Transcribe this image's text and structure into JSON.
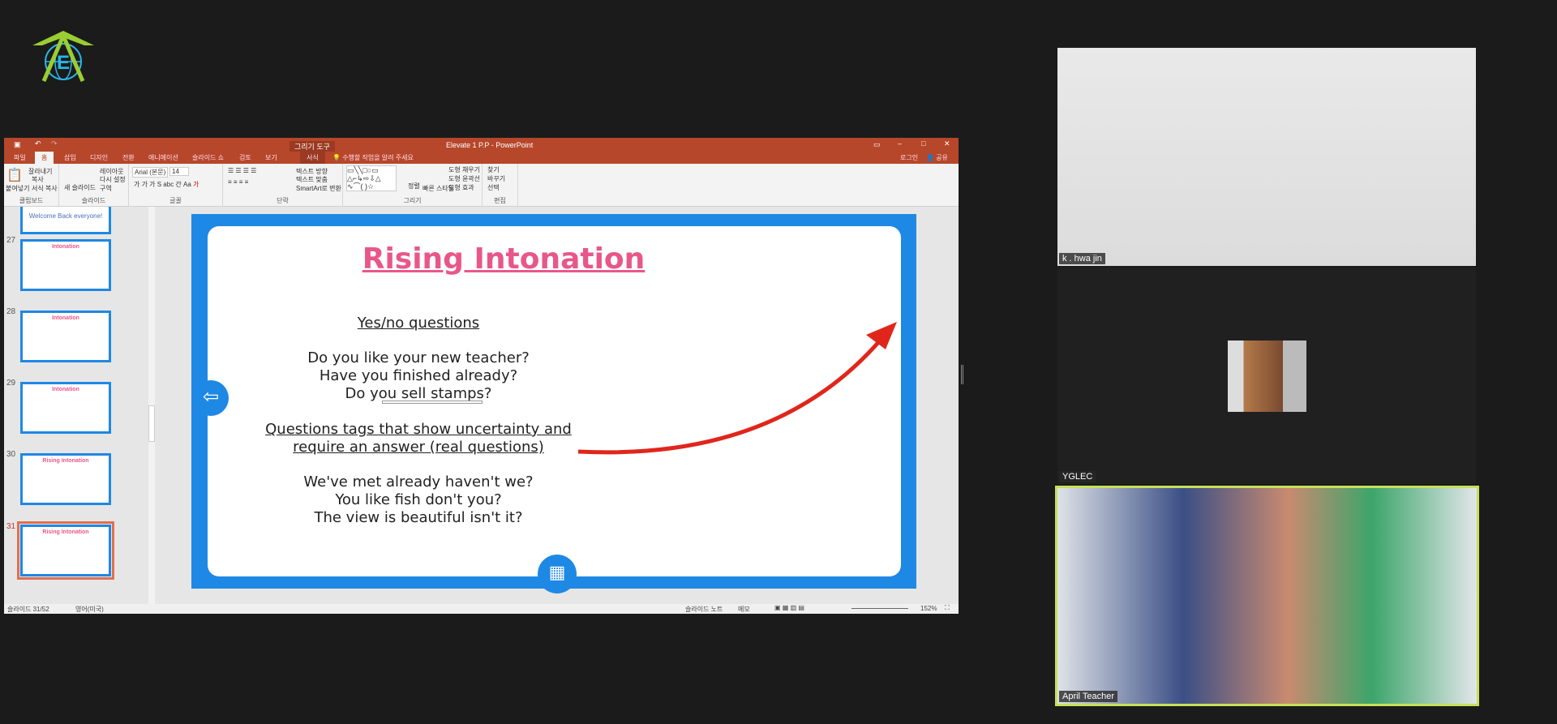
{
  "logo": {
    "name": "elevate-logo",
    "colors": {
      "arrow": "#9acd32",
      "globe": "#29b6e6"
    }
  },
  "ppt": {
    "window_title": "Elevate 1 P.P - PowerPoint",
    "context_tab": "그리기 도구",
    "tabs": [
      "파일",
      "홈",
      "삽입",
      "디자인",
      "전환",
      "애니메이션",
      "슬라이드 쇼",
      "검토",
      "보기",
      "서식"
    ],
    "tell_me": "수행할 작업을 알려 주세요",
    "signin": "로그인",
    "share": "공유",
    "ribbon": {
      "clipboard": {
        "paste": "붙여넣기",
        "cut": "잘라내기",
        "copy": "복사",
        "format_painter": "서식 복사",
        "label": "클립보드"
      },
      "slides": {
        "new_slide": "새 슬라이드",
        "layout": "레이아웃",
        "reset": "다시 설정",
        "section": "구역",
        "label": "슬라이드"
      },
      "font": {
        "name": "Arial (본문)",
        "size": "14",
        "label": "글꼴"
      },
      "paragraph": {
        "text_direction": "텍스트 방향",
        "align_text": "텍스트 맞춤",
        "smartart": "SmartArt로 변환",
        "label": "단락"
      },
      "drawing": {
        "arrange": "정렬",
        "quick_styles": "빠른 스타일",
        "fill": "도형 채우기",
        "outline": "도형 윤곽선",
        "effects": "도형 효과",
        "label": "그리기"
      },
      "editing": {
        "find": "찾기",
        "replace": "바꾸기",
        "select": "선택",
        "label": "편집"
      }
    },
    "thumbnails": [
      {
        "num": "",
        "title": "Welcome Back everyone!"
      },
      {
        "num": "27",
        "title": "Intonation"
      },
      {
        "num": "28",
        "title": "Intonation"
      },
      {
        "num": "29",
        "title": "Intonation"
      },
      {
        "num": "30",
        "title": "Rising Intonation"
      },
      {
        "num": "31",
        "title": "Rising Intonation",
        "selected": true
      }
    ],
    "status": {
      "slide": "슬라이드 31/52",
      "language": "영어(미국)",
      "notes": "슬라이드 노트",
      "comments": "메모",
      "zoom": "152%"
    }
  },
  "slide": {
    "title": "Rising Intonation",
    "heading1": "Yes/no questions",
    "q1": "Do you like your new teacher?",
    "q2": "Have you finished already?",
    "q3": "Do you sell stamps?",
    "heading2a": "Questions tags that show uncertainty and",
    "heading2b": "require an answer (real questions)",
    "t1": "We've met already haven't we?",
    "t2": "You like fish don't you?",
    "t3": "The view is beautiful isn't it?",
    "colors": {
      "title": "#e8578a",
      "frame": "#1e88e5",
      "arrow": "#e0261b"
    }
  },
  "participants": [
    {
      "name": "k . hwa jin"
    },
    {
      "name": "YGLEC"
    },
    {
      "name": "April Teacher",
      "active": true,
      "highlight": "#c6e05a"
    }
  ]
}
